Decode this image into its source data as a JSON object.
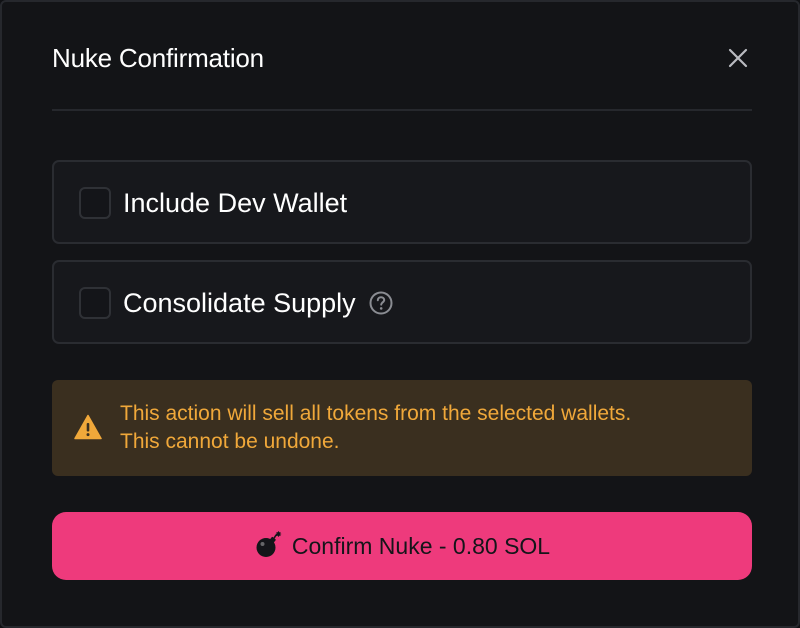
{
  "modal": {
    "title": "Nuke Confirmation"
  },
  "options": [
    {
      "label": "Include Dev Wallet",
      "checked": false
    },
    {
      "label": "Consolidate Supply",
      "checked": false
    }
  ],
  "warning": {
    "line1": "This action will sell all tokens from the selected wallets.",
    "line2": "This cannot be undone."
  },
  "confirm": {
    "label": "Confirm Nuke - 0.80 SOL"
  },
  "icons": {
    "close": "close-icon",
    "help": "question-circle-icon",
    "warning": "warning-triangle-icon",
    "bomb": "bomb-icon"
  },
  "colors": {
    "background": "#131417",
    "accent": "#ee3a7c",
    "warning_bg": "#3a2f1f",
    "warning_text": "#f0a83a"
  }
}
